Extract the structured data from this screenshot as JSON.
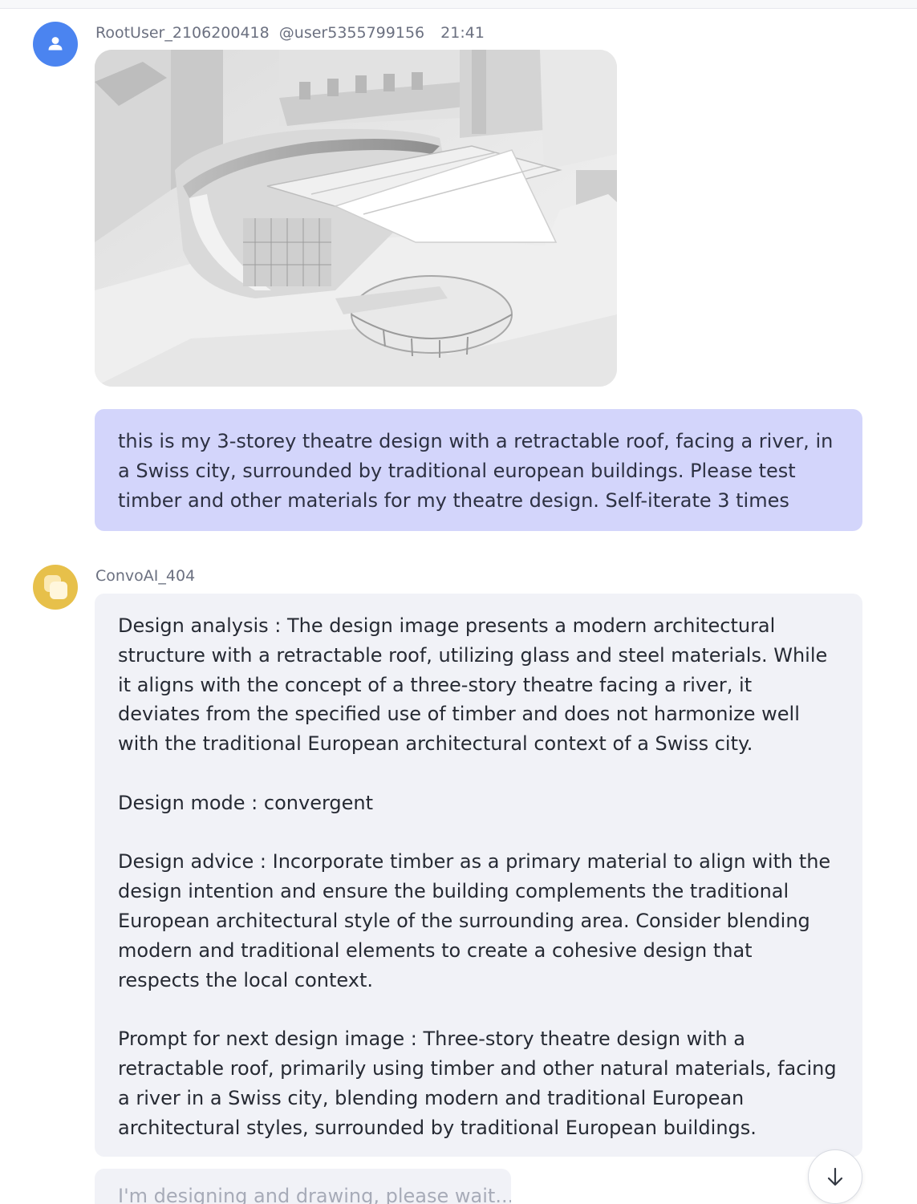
{
  "user_message": {
    "username": "RootUser_2106200418",
    "handle": "@user5355799156",
    "time": "21:41",
    "avatar_icon": "user-icon",
    "avatar_color": "#4b84f0",
    "text": "this is my 3-storey theatre design with a retractable roof, facing a river, in a Swiss city, surrounded by traditional european buildings. Please test timber and other materials for my theatre design. Self-iterate 3 times",
    "bubble_color": "#d3d5fb"
  },
  "bot_message": {
    "name": "ConvoAI_404",
    "avatar_icon": "convo-logo-icon",
    "avatar_color": "#e7c04a",
    "bubble_color": "#f1f2f7",
    "paragraphs": [
      "Design analysis : The design image presents a modern architectural structure with a retractable roof, utilizing glass and steel materials. While it aligns with the concept of a three-story theatre facing a river, it deviates from the specified use of timber and does not harmonize well with the traditional European architectural context of a Swiss city.",
      "Design mode : convergent",
      "Design advice : Incorporate timber as a primary material to align with the design intention and ensure the building complements the traditional European architectural style of the surrounding area. Consider blending modern and traditional elements to create a cohesive design that respects the local context.",
      "Prompt for next design image : Three-story theatre design with a retractable roof, primarily using timber and other natural materials, facing a river in a Swiss city, blending modern and traditional European architectural styles, surrounded by traditional European buildings."
    ]
  },
  "pending_message": {
    "text": "I'm designing and drawing, please wait..."
  },
  "scroll_button": {
    "icon": "arrow-down-icon"
  }
}
